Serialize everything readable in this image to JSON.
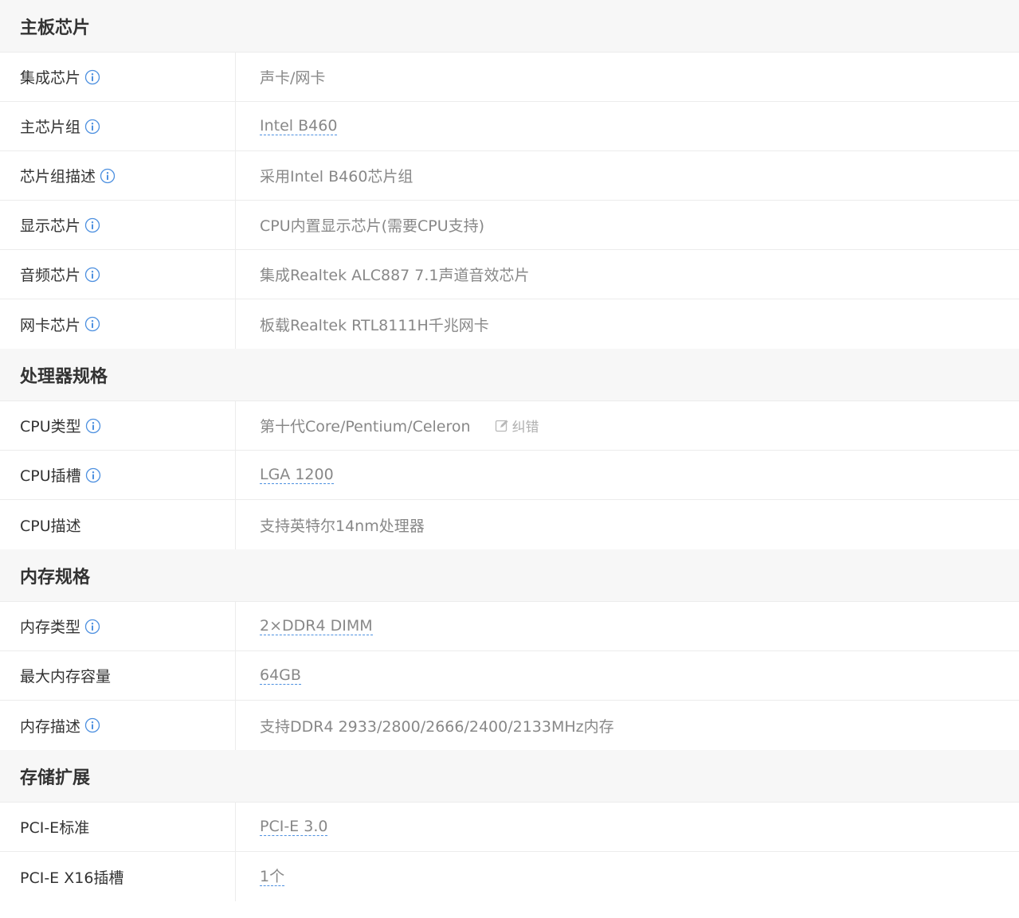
{
  "sections": [
    {
      "title": "主板芯片",
      "rows": [
        {
          "label": "集成芯片",
          "value": "声卡/网卡"
        },
        {
          "label": "主芯片组",
          "value": "Intel B460"
        },
        {
          "label": "芯片组描述",
          "value": "采用Intel B460芯片组"
        },
        {
          "label": "显示芯片",
          "value": "CPU内置显示芯片(需要CPU支持)"
        },
        {
          "label": "音频芯片",
          "value": "集成Realtek ALC887 7.1声道音效芯片"
        },
        {
          "label": "网卡芯片",
          "value": "板载Realtek RTL8111H千兆网卡"
        }
      ]
    },
    {
      "title": "处理器规格",
      "rows": [
        {
          "label": "CPU类型",
          "value": "第十代Core/Pentium/Celeron",
          "report_label": "纠错"
        },
        {
          "label": "CPU插槽",
          "value": "LGA 1200"
        },
        {
          "label": "CPU描述",
          "value": "支持英特尔14nm处理器"
        }
      ]
    },
    {
      "title": "内存规格",
      "rows": [
        {
          "label": "内存类型",
          "value": "2×DDR4 DIMM"
        },
        {
          "label": "最大内存容量",
          "value": "64GB"
        },
        {
          "label": "内存描述",
          "value": "支持DDR4 2933/2800/2666/2400/2133MHz内存"
        }
      ]
    },
    {
      "title": "存储扩展",
      "rows": [
        {
          "label": "PCI-E标准",
          "value": "PCI-E 3.0"
        },
        {
          "label": "PCI-E X16插槽",
          "value": "1个"
        }
      ]
    }
  ],
  "colors": {
    "accent_blue": "#4d90e0",
    "header_bg": "#f7f7f7",
    "label_text": "#333333",
    "value_text": "#888888"
  },
  "icons": {
    "info": "info-circle-icon",
    "report": "edit-icon"
  }
}
